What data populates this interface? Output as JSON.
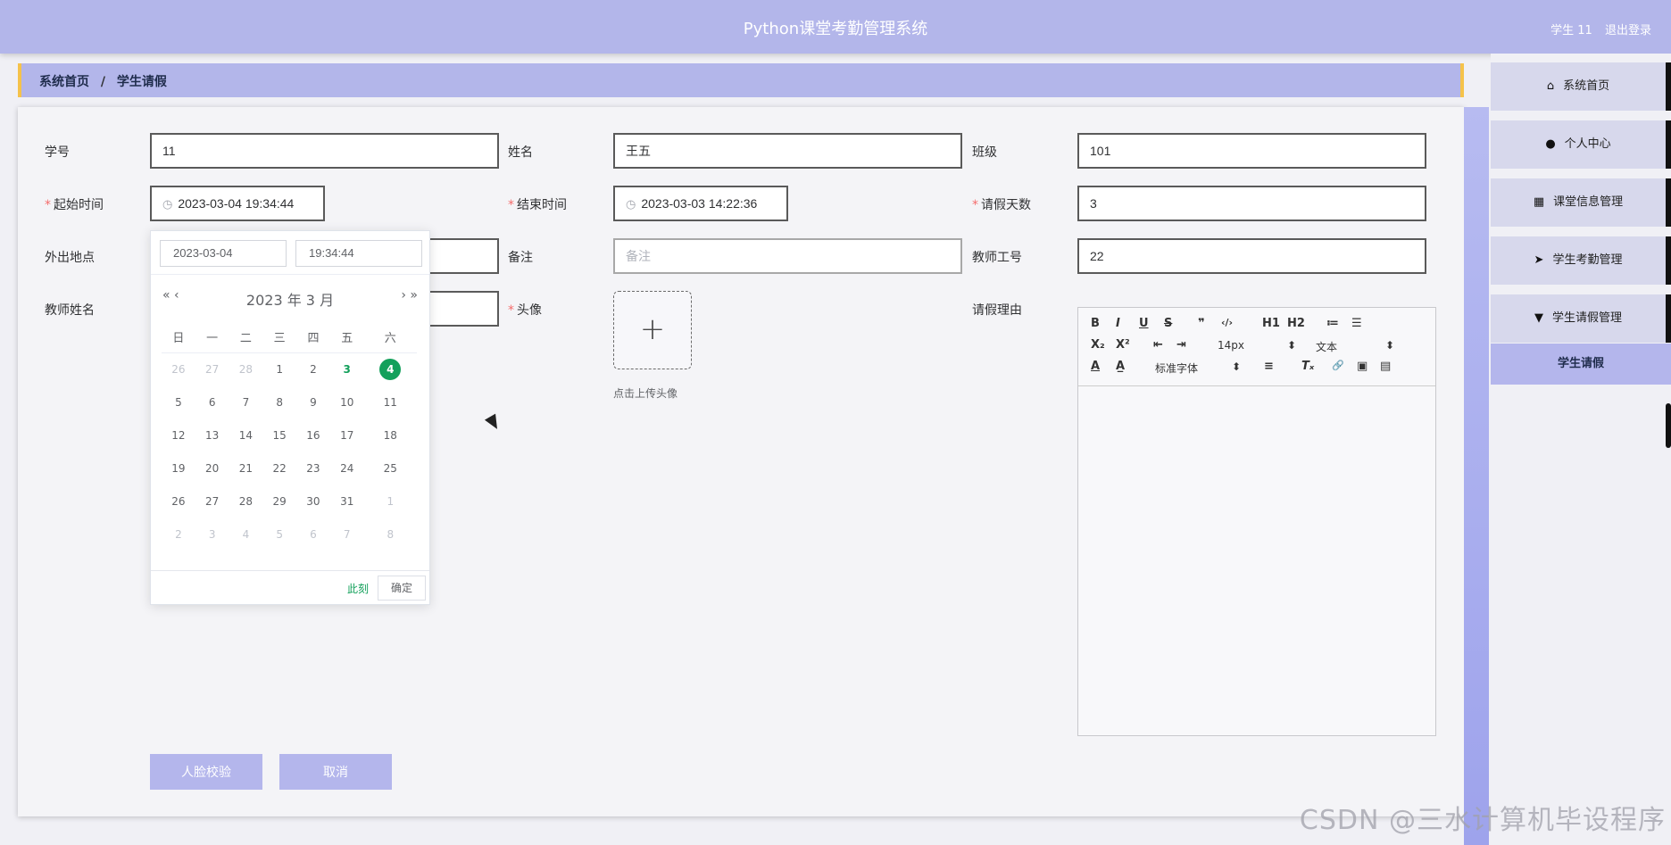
{
  "header": {
    "title": "Python课堂考勤管理系统",
    "user": "学生 11",
    "logout": "退出登录"
  },
  "breadcrumb": {
    "home": "系统首页",
    "separator": "/",
    "current": "学生请假"
  },
  "form": {
    "student_id": {
      "label": "学号",
      "value": "11"
    },
    "name": {
      "label": "姓名",
      "value": "王五"
    },
    "class": {
      "label": "班级",
      "value": "101"
    },
    "start_time": {
      "label": "起始时间",
      "value": "2023-03-04 19:34:44"
    },
    "end_time": {
      "label": "结束时间",
      "value": "2023-03-03 14:22:36"
    },
    "days": {
      "label": "请假天数",
      "value": "3"
    },
    "location": {
      "label": "外出地点",
      "value": ""
    },
    "remark": {
      "label": "备注",
      "placeholder": "备注"
    },
    "teacher_id": {
      "label": "教师工号",
      "value": "22"
    },
    "teacher_name": {
      "label": "教师姓名",
      "value": ""
    },
    "avatar": {
      "label": "头像",
      "hint": "点击上传头像",
      "plus": "+"
    },
    "reason": {
      "label": "请假理由"
    },
    "required_mark": "*"
  },
  "datepicker": {
    "date_value": "2023-03-04",
    "time_value": "19:34:44",
    "header": "2023 年  3 月",
    "prev": "« ‹",
    "next": "› »",
    "weekdays": [
      "日",
      "一",
      "二",
      "三",
      "四",
      "五",
      "六"
    ],
    "weeks": [
      [
        "26",
        "27",
        "28",
        "1",
        "2",
        "3",
        "4"
      ],
      [
        "5",
        "6",
        "7",
        "8",
        "9",
        "10",
        "11"
      ],
      [
        "12",
        "13",
        "14",
        "15",
        "16",
        "17",
        "18"
      ],
      [
        "19",
        "20",
        "21",
        "22",
        "23",
        "24",
        "25"
      ],
      [
        "26",
        "27",
        "28",
        "29",
        "30",
        "31",
        "1"
      ],
      [
        "2",
        "3",
        "4",
        "5",
        "6",
        "7",
        "8"
      ]
    ],
    "now_label": "此刻",
    "ok_label": "确定"
  },
  "editor": {
    "toolbar_row1": [
      "B",
      "I",
      "U",
      "S",
      "❞",
      "‹/›",
      "H1",
      "H2",
      "≔",
      "☰"
    ],
    "toolbar_row2": [
      "X₂",
      "X²",
      "⇤",
      "⇥"
    ],
    "size_select": "14px",
    "type_select": "文本",
    "toolbar_row3": [
      "A",
      "A̲",
      "≡",
      "Tₓ",
      "🔗",
      "▣",
      "▤"
    ],
    "font_select": "标准字体",
    "select_arrow": "⬍"
  },
  "buttons": {
    "face_check": "人脸校验",
    "cancel": "取消"
  },
  "sidebar": {
    "items": [
      {
        "label": "系统首页",
        "icon": "⌂"
      },
      {
        "label": "个人中心",
        "icon": "●"
      },
      {
        "label": "课堂信息管理",
        "icon": "▦"
      },
      {
        "label": "学生考勤管理",
        "icon": "➤"
      },
      {
        "label": "学生请假管理",
        "icon": "▼"
      }
    ],
    "active_sub": "学生请假"
  },
  "watermark": "CSDN @三水计算机毕设程序",
  "colors": {
    "header": "#b3b6ea",
    "accent_green": "#13a05b",
    "breadcrumb_border": "#f5c24a"
  }
}
